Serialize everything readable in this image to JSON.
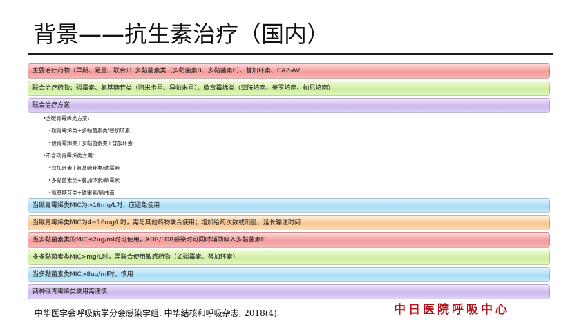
{
  "slide": {
    "title": "背景——抗生素治疗（国内）",
    "bars": [
      {
        "text": "主要治疗药物（早期、足量、联合）：多黏菌素类（多黏菌素B、多黏菌素E）、替加环素、CAZ-AVI",
        "color": "red"
      },
      {
        "text": "联合治疗药物：磷霉素、氨基糖苷类（阿米卡星、异帕米星）、碳青霉烯类（亚胺培南、美罗培南、帕尼培南）",
        "color": "green"
      },
      {
        "text": "联合治疗方案",
        "color": "purple"
      },
      {
        "text": "当碳青霉烯类MIC为>16mg/L时，应避免使用",
        "color": "blue"
      },
      {
        "text": "当碳青霉烯类MIC为4~16mg/L时，需与其他药物联合使用；增加给药次数或剂量、延长输注时间",
        "color": "orange"
      },
      {
        "text": "当多黏菌素类的MIC≤2ug/ml时可使用，XDR/PDR感染时可同时辅助吸入多黏菌素E",
        "color": "red"
      },
      {
        "text": "多多黏菌素类MIC>mg/L时，需联合使用敏感药物（如磷霉素、替加环素）",
        "color": "green"
      },
      {
        "text": "当多黏菌素类MIC>8ug/ml时，慎用",
        "color": "blue"
      },
      {
        "text": "两种碳青霉烯类联用需谨慎",
        "color": "purple"
      }
    ],
    "sub_items": [
      "•含碳青霉烯类方案：",
      "•碳青霉烯类+多黏菌素类/替加环素",
      "•碳青霉烯类+多黏菌素类+替加环素",
      "•不含碳青霉烯类方案：",
      "•替加环素+氨基糖苷类/磷霉素",
      "•多黏菌素类+替加环素/磷霉素",
      "•氨基糖苷类+磷霉素/氨曲南"
    ],
    "citation": "中华医学会呼吸病学分会感染学组. 中华结核和呼吸杂志, 2018(4).",
    "logo": "中日医院呼吸中心"
  }
}
